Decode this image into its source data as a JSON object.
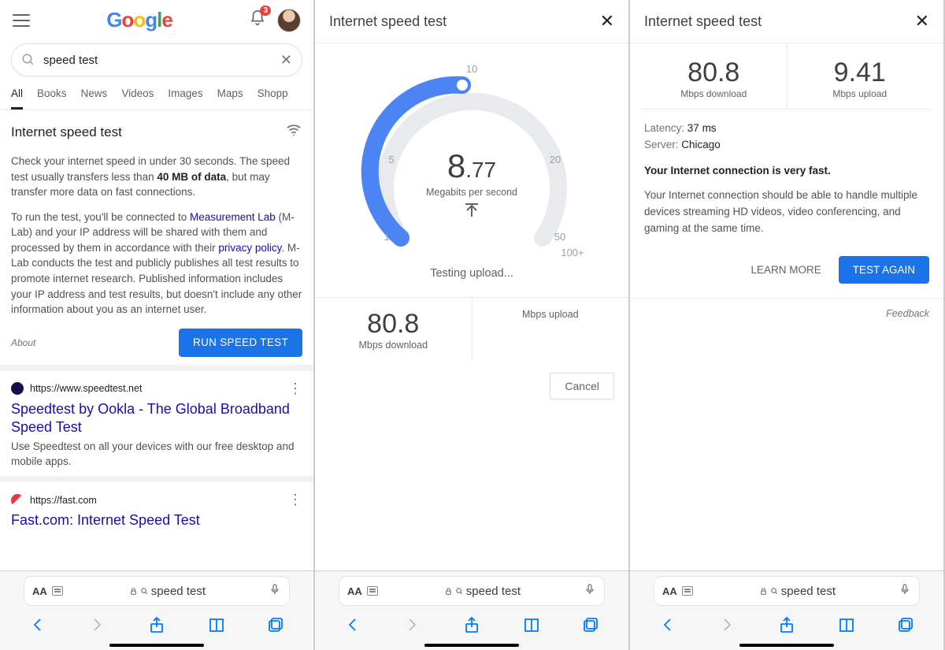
{
  "pane1": {
    "notif_count": "3",
    "search_query": "speed test",
    "tabs": [
      "All",
      "Books",
      "News",
      "Videos",
      "Images",
      "Maps",
      "Shopp"
    ],
    "active_tab": 0,
    "card": {
      "title": "Internet speed test",
      "p1a": "Check your internet speed in under 30 seconds. The speed test usually transfers less than ",
      "p1b": "40 MB of data",
      "p1c": ", but may transfer more data on fast connections.",
      "p2a": "To run the test, you'll be connected to ",
      "p2link1": "Measurement Lab",
      "p2b": " (M-Lab) and your IP address will be shared with them and processed by them in accordance with their ",
      "p2link2": "privacy policy",
      "p2c": ". M-Lab conducts the test and publicly publishes all test results to promote internet research. Published information includes your IP address and test results, but doesn't include any other information about you as an internet user.",
      "about": "About",
      "run": "RUN SPEED TEST"
    },
    "results": [
      {
        "url": "https://www.speedtest.net",
        "title": "Speedtest by Ookla - The Global Broadband Speed Test",
        "snippet": "Use Speedtest on all your devices with our free desktop and mobile apps."
      },
      {
        "url": "https://fast.com",
        "title": "Fast.com: Internet Speed Test",
        "snippet": ""
      }
    ]
  },
  "pane2": {
    "title": "Internet speed test",
    "ticks": {
      "t1": "1",
      "t5": "5",
      "t10": "10",
      "t20": "20",
      "t50": "50",
      "t100": "100+"
    },
    "value_int": "8",
    "value_dec": ".77",
    "unit": "Megabits per second",
    "status": "Testing upload...",
    "dl_val": "80.8",
    "dl_lab": "Mbps download",
    "ul_val": "",
    "ul_lab": "Mbps upload",
    "cancel": "Cancel"
  },
  "pane3": {
    "title": "Internet speed test",
    "dl_val": "80.8",
    "dl_lab": "Mbps download",
    "ul_val": "9.41",
    "ul_lab": "Mbps upload",
    "lat_k": "Latency: ",
    "lat_v": "37 ms",
    "srv_k": "Server: ",
    "srv_v": "Chicago",
    "headline": "Your Internet connection is very fast.",
    "desc": "Your Internet connection should be able to handle multiple devices streaming HD videos, video conferencing, and gaming at the same time.",
    "learn": "LEARN MORE",
    "again": "TEST AGAIN",
    "feedback": "Feedback"
  },
  "safari": {
    "addr": "speed test"
  }
}
